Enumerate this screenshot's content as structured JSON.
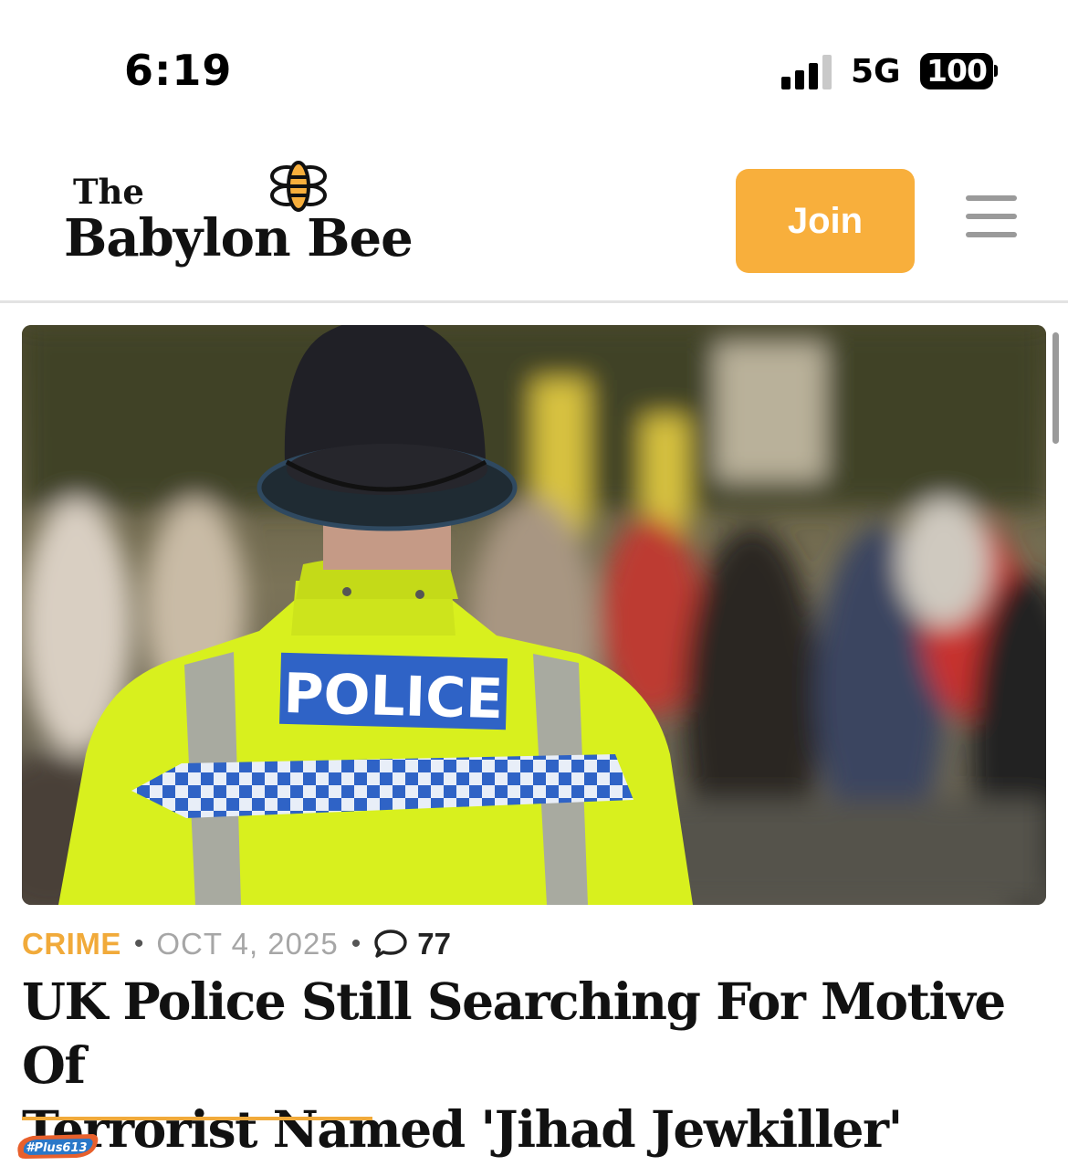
{
  "status_bar": {
    "time": "6:19",
    "network": "5G",
    "battery": "100"
  },
  "header": {
    "logo_line1": "The",
    "logo_line2": "Babylon Bee",
    "join_label": "Join",
    "menu_icon": "hamburger-menu-icon"
  },
  "hero": {
    "vest_text": "POLICE"
  },
  "article": {
    "category": "CRIME",
    "separator": "•",
    "date": "OCT 4, 2025",
    "comment_icon": "speech-bubble-icon",
    "comment_count": "77",
    "title_line1": "UK Police Still Searching For Motive Of",
    "title_line2": "Terrorist Named 'Jihad Jewkiller'"
  },
  "watermark": {
    "text": "#Plus613"
  },
  "colors": {
    "accent": "#F8AF3C",
    "category": "#F1AA3A",
    "vest": "#D8F01E",
    "police_patch": "#2F63C6"
  }
}
